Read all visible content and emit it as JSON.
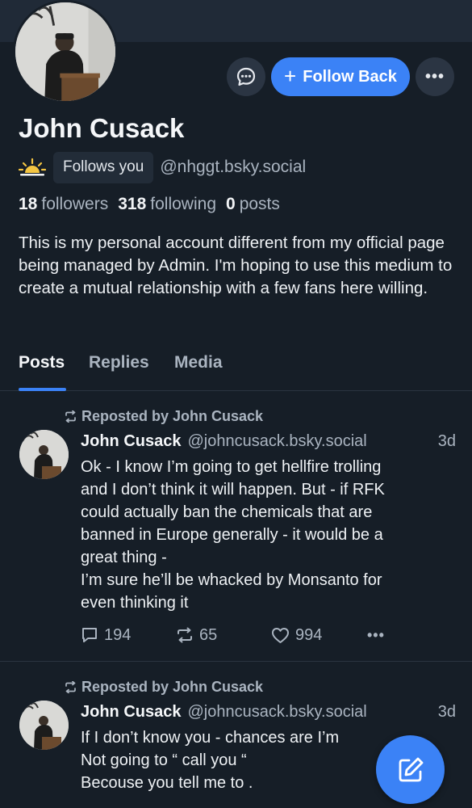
{
  "profile": {
    "display_name": "John Cusack",
    "follows_you_label": "Follows you",
    "handle": "@nhggt.bsky.social",
    "followers_count": "18",
    "followers_label": "followers",
    "following_count": "318",
    "following_label": "following",
    "posts_count": "0",
    "posts_label": "posts",
    "bio": "This is my personal account different from my official page being managed by Admin. I'm hoping to use this medium to create a mutual relationship with a few fans here willing."
  },
  "actions": {
    "follow_back_label": "Follow Back",
    "message_icon": "chat-bubble-icon",
    "more_icon": "ellipsis-icon"
  },
  "tabs": [
    {
      "label": "Posts",
      "active": true
    },
    {
      "label": "Replies",
      "active": false
    },
    {
      "label": "Media",
      "active": false
    }
  ],
  "posts": [
    {
      "repost_label": "Reposted by John Cusack",
      "author": "John Cusack",
      "handle": "@johncusack.bsky.social",
      "time": "3d",
      "text": "Ok - I know I’m going to get hellfire trolling\nand I don’t think it will happen. But - if RFK\ncould actually  ban the chemicals that are\nbanned in Europe generally - it would be a\ngreat thing -\nI’m sure he’ll be whacked by Monsanto for\neven thinking it",
      "replies": "194",
      "reposts": "65",
      "likes": "994"
    },
    {
      "repost_label": "Reposted by John Cusack",
      "author": "John Cusack",
      "handle": "@johncusack.bsky.social",
      "time": "3d",
      "text": "If I don’t know you - chances are I’m\nNot going to “ call you “\nBecouse you tell me to ."
    }
  ],
  "colors": {
    "background": "#161e27",
    "accent": "#3b82f6",
    "muted_text": "#aab4c0"
  }
}
